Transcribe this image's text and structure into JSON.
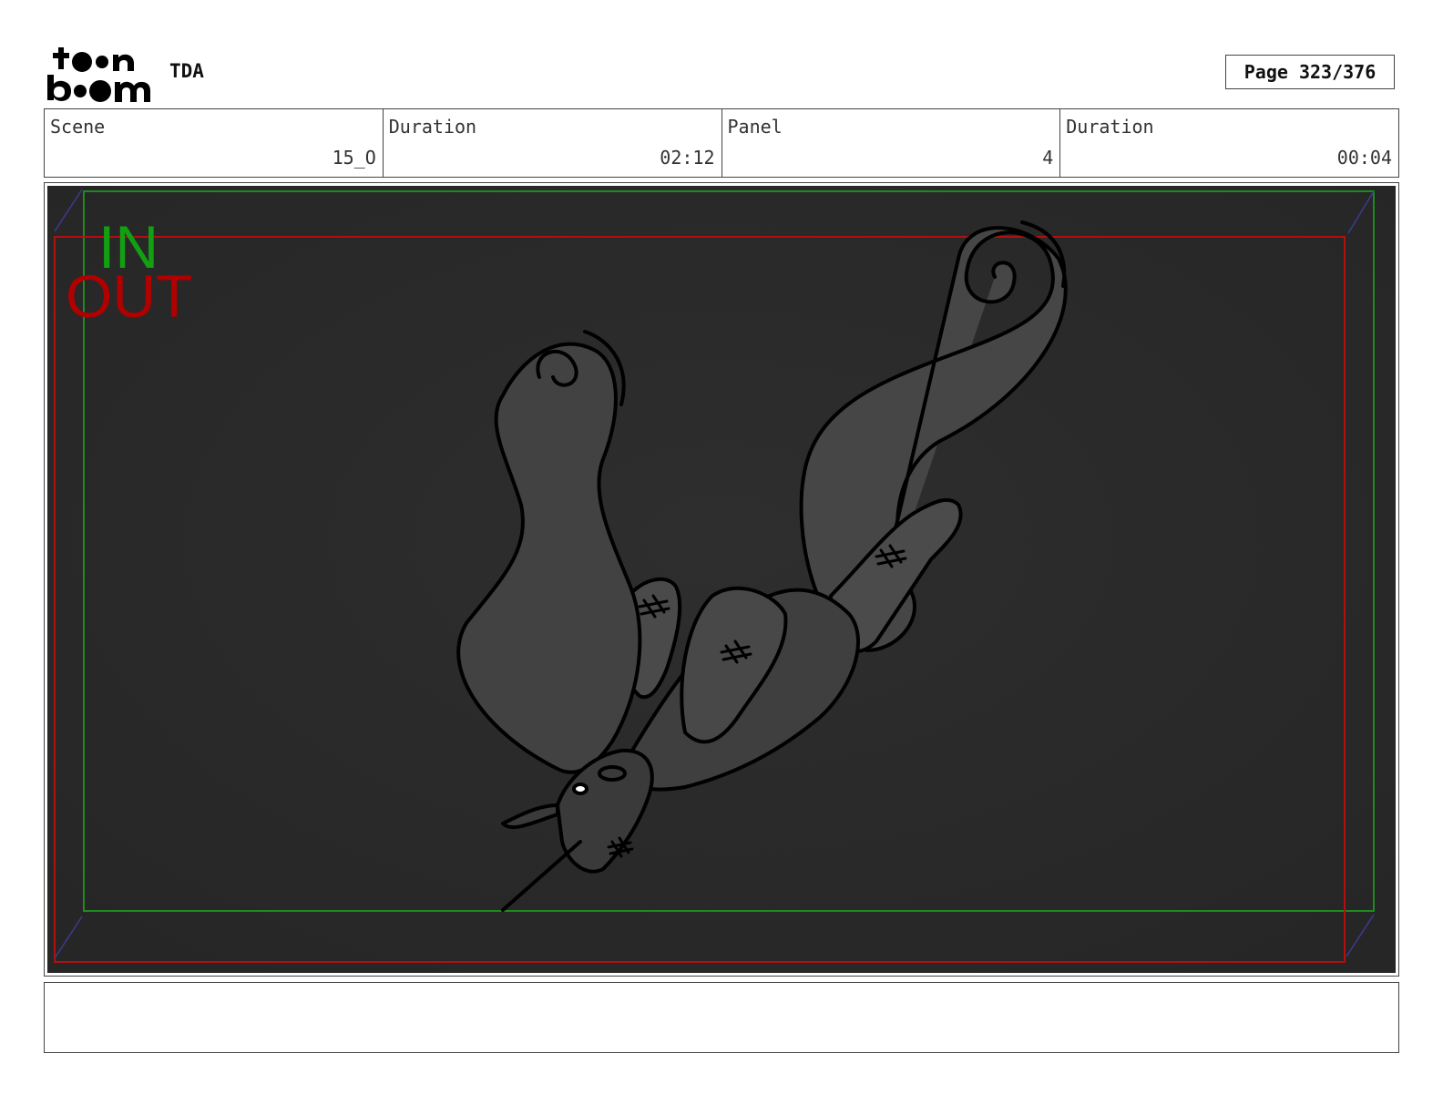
{
  "header": {
    "logo": "toon-boom-logo",
    "project": "TDA",
    "page_label": "Page 323/376"
  },
  "info": {
    "scene_label": "Scene",
    "scene_value": "15_O",
    "scene_duration_label": "Duration",
    "scene_duration_value": "02:12",
    "panel_label": "Panel",
    "panel_value": "4",
    "panel_duration_label": "Duration",
    "panel_duration_value": "00:04"
  },
  "panel": {
    "in_label": "IN",
    "out_label": "OUT",
    "in_color": "#12a012",
    "out_color": "#b00000",
    "background_color": "#2b2b2b"
  },
  "notes": {
    "text": ""
  }
}
